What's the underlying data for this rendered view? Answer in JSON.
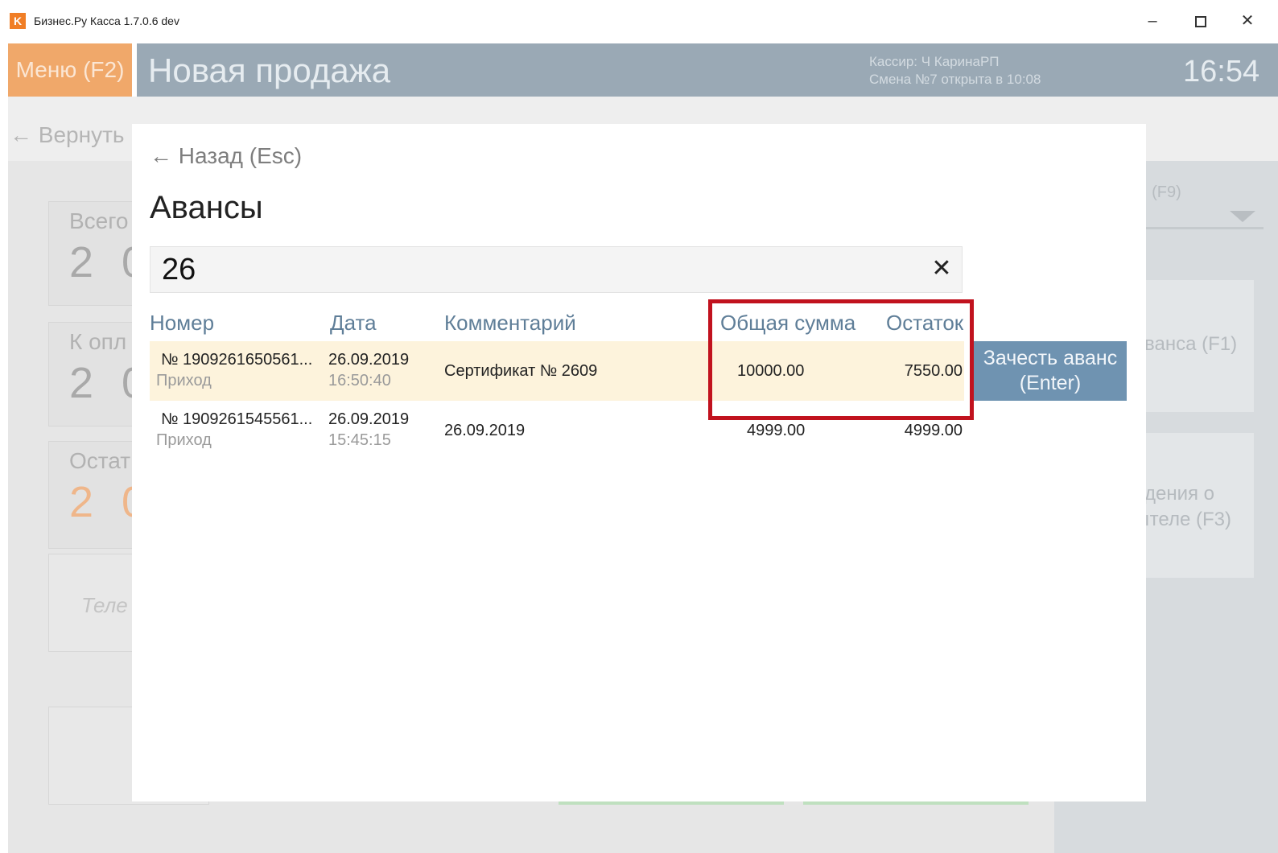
{
  "window": {
    "app_icon": "K",
    "title": "Бизнес.Ру Касса 1.7.0.6 dev",
    "minimize": "–",
    "close": "✕"
  },
  "header": {
    "menu_label": "Меню (F2)",
    "page_title": "Новая продажа",
    "cashier": "Кассир: Ч КаринаРП",
    "shift": "Смена №7 открыта в 10:08",
    "time": "16:54"
  },
  "background": {
    "back_link": "← Вернуть",
    "total_label": "Всего",
    "total_value": "2 0",
    "to_pay_label": "К опл",
    "to_pay_value": "2 0",
    "remaining_label": "Остат",
    "remaining_value": "2 0",
    "phone_placeholder": "Теле",
    "right_label": "ı (F9)",
    "right_btn1": "ванса (F1)",
    "right_btn2_line1": "дения о",
    "right_btn2_line2": "ıтеле (F3)"
  },
  "modal": {
    "back_label": "← Назад (Esc)",
    "title": "Авансы",
    "search_value": "26",
    "clear_icon": "✕",
    "columns": {
      "number": "Номер",
      "date": "Дата",
      "comment": "Комментарий",
      "total": "Общая сумма",
      "remainder": "Остаток"
    },
    "rows": [
      {
        "number": "№ 1909261650561...",
        "type": "Приход",
        "date": "26.09.2019",
        "time": "16:50:40",
        "comment": "Сертификат № 2609",
        "total": "10000.00",
        "remainder": "7550.00"
      },
      {
        "number": "№ 1909261545561...",
        "type": "Приход",
        "date": "26.09.2019",
        "time": "15:45:15",
        "comment": "26.09.2019",
        "total": "4999.00",
        "remainder": "4999.00"
      }
    ],
    "apply_line1": "Зачесть аванс",
    "apply_line2": "(Enter)"
  },
  "colors": {
    "accent_orange": "#f0a86a",
    "header_gray": "#9aa9b5",
    "selected_row": "#fdf3dc",
    "apply_button": "#6f93b1",
    "highlight_red": "#c1121e"
  }
}
